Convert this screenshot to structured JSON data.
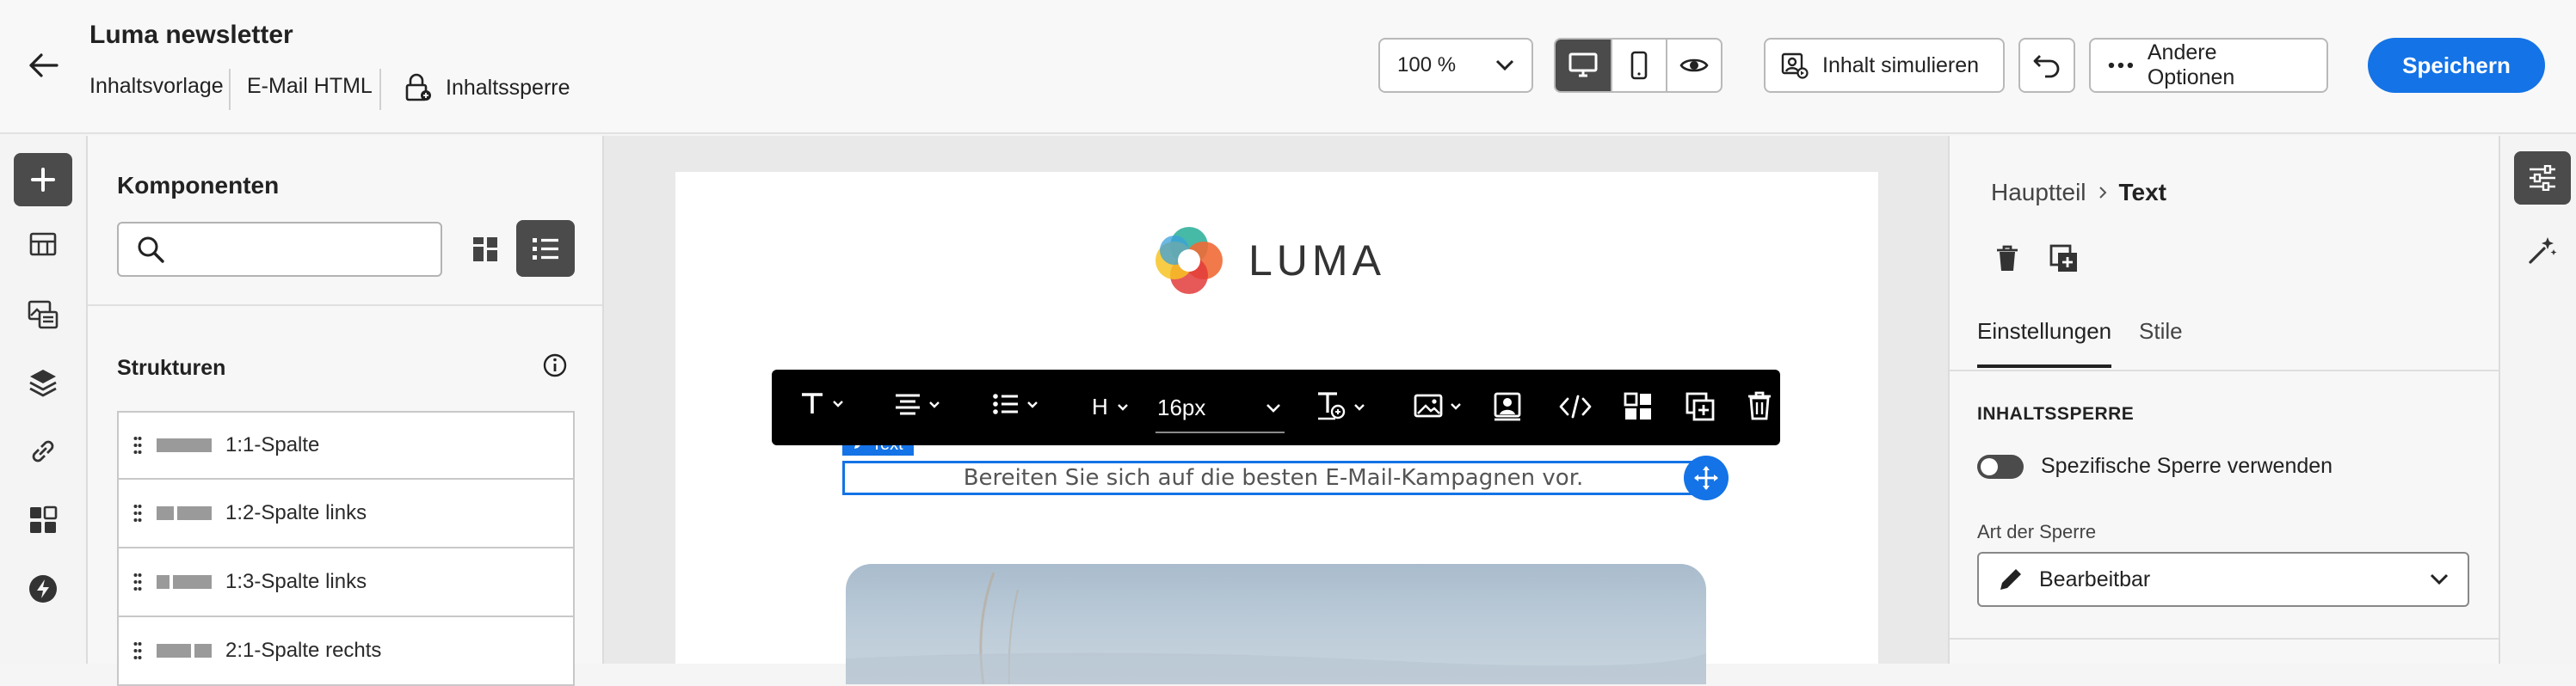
{
  "header": {
    "title": "Luma newsletter",
    "meta": [
      "Inhaltsvorlage",
      "E-Mail HTML"
    ],
    "lock_label": "Inhaltssperre",
    "zoom": "100 %",
    "simulate_label": "Inhalt simulieren",
    "more_label": "Andere Optionen",
    "save_label": "Speichern"
  },
  "components": {
    "title": "Komponenten",
    "search_placeholder": "",
    "structures_title": "Strukturen",
    "structures": [
      "1:1-Spalte",
      "1:2-Spalte links",
      "1:3-Spalte links",
      "2:1-Spalte rechts"
    ]
  },
  "email": {
    "logo_text": "LUMA",
    "text_tag": "Text",
    "body_text": "Bereiten Sie sich auf die besten E-Mail-Kampagnen vor.",
    "font_size": "16px",
    "heading_label": "H"
  },
  "properties": {
    "breadcrumb_parent": "Hauptteil",
    "breadcrumb_current": "Text",
    "tabs": [
      "Einstellungen",
      "Stile"
    ],
    "section_title": "INHALTSSPERRE",
    "toggle_label": "Spezifische Sperre verwenden",
    "lock_type_label": "Art der Sperre",
    "lock_type_value": "Bearbeitbar"
  },
  "colors": {
    "accent": "#1473e6",
    "save_button": "#1473e6",
    "toolbar_bg": "#000000",
    "dark_button": "#4b4b4b"
  }
}
